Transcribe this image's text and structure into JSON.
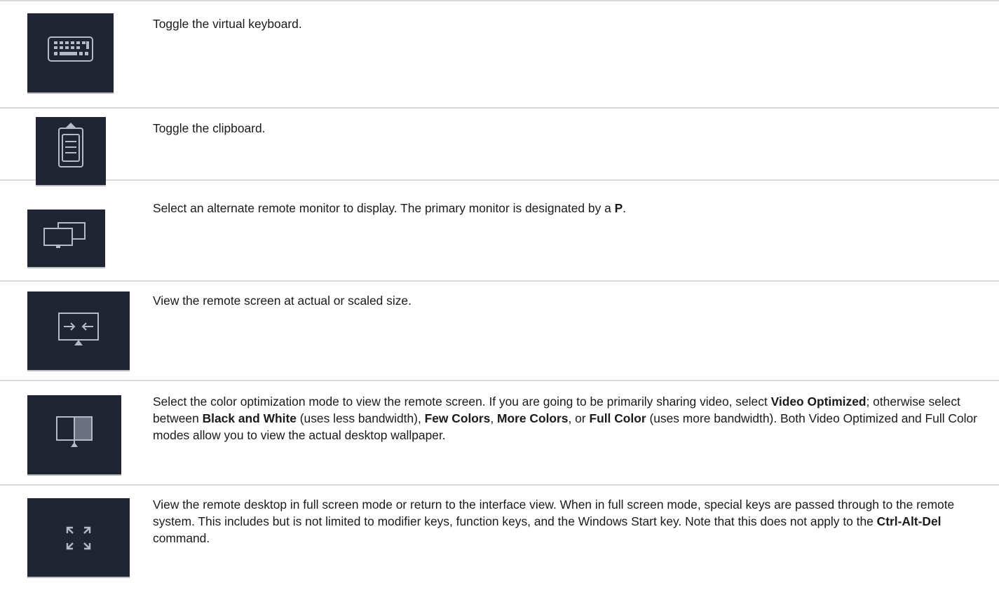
{
  "rows": [
    {
      "icon": "keyboard-icon",
      "segments": [
        {
          "text": "Toggle the virtual keyboard.",
          "bold": false
        }
      ]
    },
    {
      "icon": "clipboard-icon",
      "segments": [
        {
          "text": "Toggle the clipboard.",
          "bold": false
        }
      ]
    },
    {
      "icon": "monitors-icon",
      "segments": [
        {
          "text": "Select an alternate remote monitor to display. The primary monitor is designated by a ",
          "bold": false
        },
        {
          "text": "P",
          "bold": true
        },
        {
          "text": ".",
          "bold": false
        }
      ]
    },
    {
      "icon": "scale-screen-icon",
      "segments": [
        {
          "text": "View the remote screen at actual or scaled size.",
          "bold": false
        }
      ]
    },
    {
      "icon": "color-mode-icon",
      "segments": [
        {
          "text": "Select the color optimization mode to view the remote screen. If you are going to be primarily sharing video, select ",
          "bold": false
        },
        {
          "text": "Video Optimized",
          "bold": true
        },
        {
          "text": "; otherwise select between ",
          "bold": false
        },
        {
          "text": "Black and White",
          "bold": true
        },
        {
          "text": " (uses less bandwidth), ",
          "bold": false
        },
        {
          "text": "Few Colors",
          "bold": true
        },
        {
          "text": ", ",
          "bold": false
        },
        {
          "text": "More Colors",
          "bold": true
        },
        {
          "text": ", or ",
          "bold": false
        },
        {
          "text": "Full Color",
          "bold": true
        },
        {
          "text": " (uses more bandwidth). Both Video Optimized and Full Color modes allow you to view the actual desktop wallpaper.",
          "bold": false
        }
      ]
    },
    {
      "icon": "fullscreen-icon",
      "segments": [
        {
          "text": "View the remote desktop in full screen mode or return to the interface view. When in full screen mode, special keys are passed through to the remote system. This includes but is not limited to modifier keys, function keys, and the Windows Start key. Note that this does not apply to the ",
          "bold": false
        },
        {
          "text": "Ctrl-Alt-Del",
          "bold": true
        },
        {
          "text": " command.",
          "bold": false
        }
      ]
    }
  ],
  "colors": {
    "icon_bg": "#1f2532",
    "icon_stroke": "#b5bac4",
    "border": "#dadada"
  }
}
